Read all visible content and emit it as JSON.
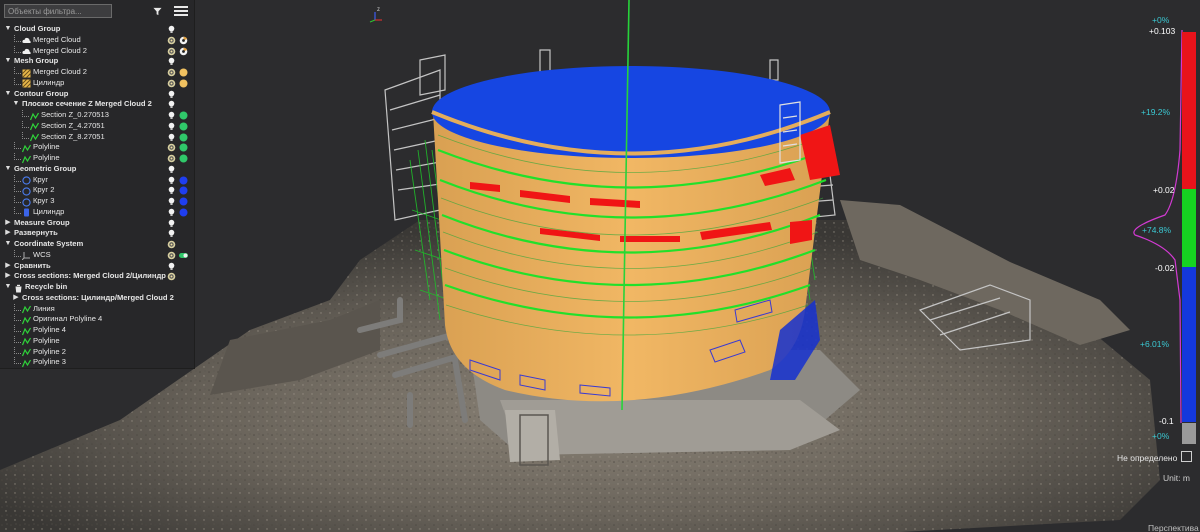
{
  "toolbar": {
    "filter_placeholder": "Объекты фильтра...",
    "filter_value": "",
    "filter_icon": "filter-icon",
    "menu_icon": "hamburger-menu-icon"
  },
  "tree": [
    {
      "label": "Cloud Group",
      "group": true,
      "level": 0,
      "expand": "down",
      "c1": "bulb",
      "c2": ""
    },
    {
      "label": "Merged Cloud",
      "level": 2,
      "icon": "cloud",
      "c1": "shield",
      "c2": "gauge"
    },
    {
      "label": "Merged Cloud 2",
      "level": 2,
      "icon": "cloud",
      "c1": "shield",
      "c2": "gauge"
    },
    {
      "label": "Mesh Group",
      "group": true,
      "level": 0,
      "expand": "down",
      "c1": "bulb",
      "c2": ""
    },
    {
      "label": "Merged Cloud 2",
      "level": 2,
      "icon": "mesh",
      "c1": "shield",
      "c2": "dot-yellow"
    },
    {
      "label": "Цилиндр",
      "level": 2,
      "icon": "mesh",
      "c1": "shield",
      "c2": "dot-yellow"
    },
    {
      "label": "Contour Group",
      "group": true,
      "level": 0,
      "expand": "down",
      "c1": "bulb",
      "c2": ""
    },
    {
      "label": "Плоское сечение Z Merged Cloud 2",
      "group": true,
      "level": 1,
      "expand": "down",
      "c1": "bulb",
      "c2": ""
    },
    {
      "label": "Section Z_0.270513",
      "level": 3,
      "icon": "polyline",
      "c1": "bulb",
      "c2": "dot-green"
    },
    {
      "label": "Section Z_4.27051",
      "level": 3,
      "icon": "polyline",
      "c1": "bulb",
      "c2": "dot-green"
    },
    {
      "label": "Section Z_8.27051",
      "level": 3,
      "icon": "polyline",
      "c1": "bulb",
      "c2": "dot-green"
    },
    {
      "label": "Polyline",
      "level": 2,
      "icon": "polyline",
      "c1": "shield",
      "c2": "dot-green"
    },
    {
      "label": "Polyline",
      "level": 2,
      "icon": "polyline",
      "c1": "shield",
      "c2": "dot-green"
    },
    {
      "label": "Geometric Group",
      "group": true,
      "level": 0,
      "expand": "down",
      "c1": "bulb",
      "c2": ""
    },
    {
      "label": "Круг",
      "level": 2,
      "icon": "circle",
      "c1": "bulb",
      "c2": "dot-blue"
    },
    {
      "label": "Круг 2",
      "level": 2,
      "icon": "circle",
      "c1": "bulb",
      "c2": "dot-blue"
    },
    {
      "label": "Круг 3",
      "level": 2,
      "icon": "circle",
      "c1": "bulb",
      "c2": "dot-blue"
    },
    {
      "label": "Цилиндр",
      "level": 2,
      "icon": "cylinder",
      "c1": "bulb",
      "c2": "dot-blue"
    },
    {
      "label": "Measure Group",
      "group": true,
      "level": 0,
      "expand": "right",
      "c1": "bulb",
      "c2": ""
    },
    {
      "label": "Развернуть",
      "group": true,
      "level": 0,
      "expand": "right",
      "c1": "bulb",
      "c2": ""
    },
    {
      "label": "Coordinate System",
      "group": true,
      "level": 0,
      "expand": "down",
      "c1": "shield",
      "c2": ""
    },
    {
      "label": "WCS",
      "level": 2,
      "icon": "axes",
      "c1": "shield",
      "c2": "toggle"
    },
    {
      "label": "Сравнить",
      "group": true,
      "level": 0,
      "expand": "right",
      "c1": "bulb",
      "c2": ""
    },
    {
      "label": "Cross sections: Merged Cloud 2/Цилиндр",
      "group": true,
      "level": 0,
      "expand": "right",
      "c1": "shield",
      "c2": ""
    },
    {
      "label": "Recycle bin",
      "group": true,
      "level": 0,
      "expand": "down",
      "icon": "trash",
      "c1": "",
      "c2": ""
    },
    {
      "label": "Cross sections: Цилиндр/Merged Cloud 2",
      "group": true,
      "level": 1,
      "expand": "right",
      "c1": "",
      "c2": ""
    },
    {
      "label": "Линия",
      "level": 2,
      "icon": "polyline",
      "c1": "",
      "c2": ""
    },
    {
      "label": "Оригинал Polyline 4",
      "level": 2,
      "icon": "polyline",
      "c1": "",
      "c2": ""
    },
    {
      "label": "Polyline 4",
      "level": 2,
      "icon": "polyline",
      "c1": "",
      "c2": ""
    },
    {
      "label": "Polyline",
      "level": 2,
      "icon": "polyline",
      "c1": "",
      "c2": ""
    },
    {
      "label": "Polyline 2",
      "level": 2,
      "icon": "polyline",
      "c1": "",
      "c2": ""
    },
    {
      "label": "Polyline 3",
      "level": 2,
      "icon": "polyline",
      "c1": "",
      "c2": ""
    }
  ],
  "scale": {
    "labels": {
      "top_pct": "+0%",
      "max": "+0.103",
      "red_pct": "+19.2%",
      "upper": "+0.02",
      "green_pct": "+74.8%",
      "lower": "-0.02",
      "blue_pct": "+6.01%",
      "min": "-0.1",
      "bottom_pct": "+0%"
    },
    "not_defined_label": "Не определено",
    "unit_label": "Unit: m",
    "colors": {
      "red": "#e8131b",
      "green": "#16d321",
      "blue": "#1438dc",
      "gray": "#9a9a9a",
      "histogram": "#d23ad2",
      "pct": "#3bc8d2"
    }
  },
  "viewport": {
    "perspective_label": "Перспектива",
    "axis_label": "z",
    "object_colors": {
      "cylinder": "#e9ad5a",
      "cylinder_top": "#1546e0",
      "ground": "#7a7268",
      "scaffold": "#bdbdbd"
    }
  }
}
